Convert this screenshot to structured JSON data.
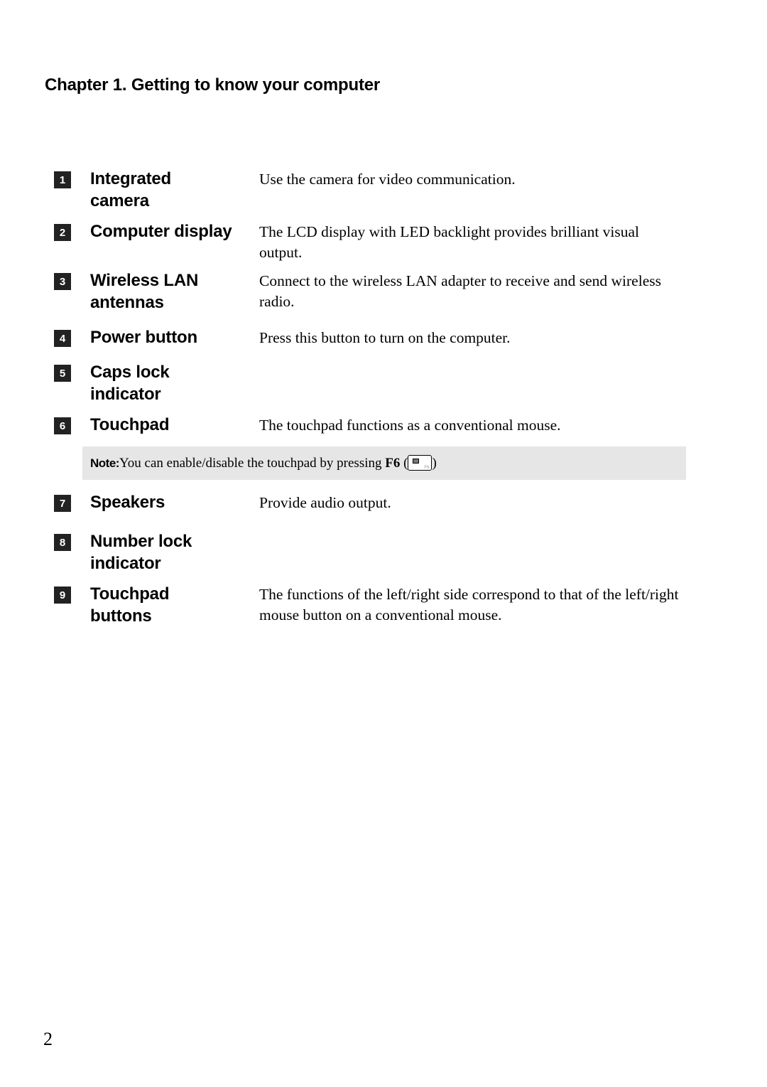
{
  "chapter_title": "Chapter 1. Getting to know your computer",
  "items": [
    {
      "number": "1",
      "term": "Integrated camera",
      "description": "Use the camera for video communication."
    },
    {
      "number": "2",
      "term": "Computer display",
      "description": "The LCD display with LED backlight provides brilliant visual output."
    },
    {
      "number": "3",
      "term": "Wireless LAN antennas",
      "description": "Connect to the wireless LAN adapter to receive and send wireless radio."
    },
    {
      "number": "4",
      "term": "Power button",
      "description": "Press this button to turn on the computer."
    },
    {
      "number": "5",
      "term": "Caps lock indicator",
      "description": ""
    },
    {
      "number": "6",
      "term": "Touchpad",
      "description": "The touchpad functions as a conventional mouse."
    },
    {
      "number": "7",
      "term": "Speakers",
      "description": "Provide audio output."
    },
    {
      "number": "8",
      "term": "Number lock indicator",
      "description": ""
    },
    {
      "number": "9",
      "term": "Touchpad buttons",
      "description": "The functions of the left/right side correspond to that of the left/right mouse button on a conventional mouse."
    }
  ],
  "note": {
    "label": "Note:",
    "text": "You can enable/disable the touchpad by pressing ",
    "key": "F6",
    "open_paren": " (",
    "close_paren": ")",
    "key_icon_sub": "F6",
    "icon": "touchpad-toggle-key-icon"
  },
  "page_number": "2"
}
